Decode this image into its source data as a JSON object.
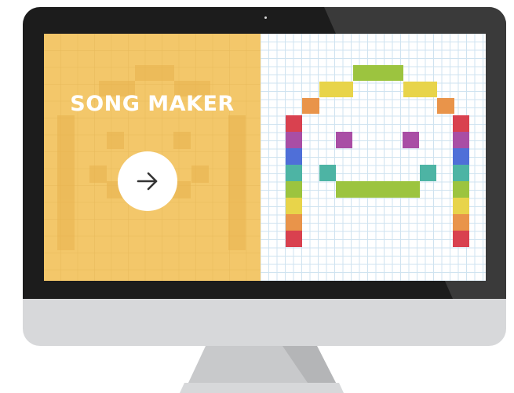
{
  "app": {
    "title": "SONG MAKER",
    "play_icon": "arrow-right-icon"
  },
  "colors": {
    "bezel": "#1c1c1c",
    "chin": "#d7d8da",
    "left_bg": "#f3c76a",
    "grid_line": "#cfe3f0",
    "notes": {
      "red": "#d9414f",
      "purple": "#a94ea5",
      "blue": "#4f6fd8",
      "teal": "#4db4a4",
      "green": "#9cc43f",
      "yellow": "#e8d44a",
      "orange": "#e9944a"
    }
  }
}
